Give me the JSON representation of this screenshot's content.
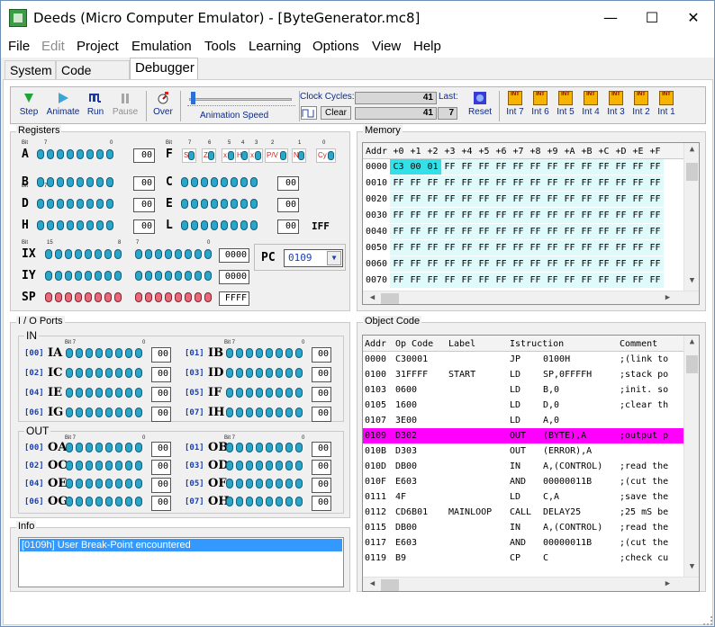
{
  "window": {
    "title": "Deeds (Micro Computer Emulator) - [ByteGenerator.mc8]",
    "min": "—",
    "max": "☐",
    "close": "✕"
  },
  "menu": [
    "File",
    "Edit",
    "Project",
    "Emulation",
    "Tools",
    "Learning",
    "Options",
    "View",
    "Help"
  ],
  "tabs": [
    "System",
    "Code Editor",
    "Debugger"
  ],
  "toolbar": {
    "buttons": [
      "Step",
      "Animate",
      "Run",
      "Pause",
      "Over"
    ],
    "animate_speed": "Animation Speed",
    "clock_label": "Clock Cycles:",
    "last_label": "Last:",
    "clear": "Clear",
    "clock1": "41",
    "clock2": "41",
    "last": "7",
    "reset": "Reset",
    "ints": [
      "Int 7",
      "Int 6",
      "Int 5",
      "Int 4",
      "Int 3",
      "Int 2",
      "Int 1"
    ]
  },
  "registers": {
    "title": "Registers",
    "bit_label": "Bit",
    "b7": "7",
    "b0": "0",
    "b15": "15",
    "b8": "8",
    "A": {
      "name": "A",
      "val": "00"
    },
    "B": {
      "name": "B",
      "val": "00"
    },
    "D": {
      "name": "D",
      "val": "00"
    },
    "H": {
      "name": "H",
      "val": "00"
    },
    "C": {
      "name": "C",
      "val": "00"
    },
    "E": {
      "name": "E",
      "val": "00"
    },
    "L": {
      "name": "L",
      "val": "00"
    },
    "F": {
      "name": "F",
      "flags": [
        "S",
        "Z",
        "x",
        "H",
        "x",
        "P/V",
        "N",
        "Cy"
      ],
      "bits": [
        "7",
        "6",
        "5",
        "4",
        "3",
        "2",
        "1",
        "0"
      ]
    },
    "IFF": "IFF",
    "IX": {
      "name": "IX",
      "val": "0000"
    },
    "IY": {
      "name": "IY",
      "val": "0000"
    },
    "SP": {
      "name": "SP",
      "val": "FFFF"
    },
    "PC": {
      "name": "PC",
      "val": "0109"
    }
  },
  "memory": {
    "title": "Memory",
    "header": [
      "Addr",
      "+0",
      "+1",
      "+2",
      "+3",
      "+4",
      "+5",
      "+6",
      "+7",
      "+8",
      "+9",
      "+A",
      "+B",
      "+C",
      "+D",
      "+E",
      "+F"
    ],
    "rows": [
      [
        "0000",
        "C3",
        "00",
        "01",
        "FF",
        "FF",
        "FF",
        "FF",
        "FF",
        "FF",
        "FF",
        "FF",
        "FF",
        "FF",
        "FF",
        "FF",
        "FF"
      ],
      [
        "0010",
        "FF",
        "FF",
        "FF",
        "FF",
        "FF",
        "FF",
        "FF",
        "FF",
        "FF",
        "FF",
        "FF",
        "FF",
        "FF",
        "FF",
        "FF",
        "FF"
      ],
      [
        "0020",
        "FF",
        "FF",
        "FF",
        "FF",
        "FF",
        "FF",
        "FF",
        "FF",
        "FF",
        "FF",
        "FF",
        "FF",
        "FF",
        "FF",
        "FF",
        "FF"
      ],
      [
        "0030",
        "FF",
        "FF",
        "FF",
        "FF",
        "FF",
        "FF",
        "FF",
        "FF",
        "FF",
        "FF",
        "FF",
        "FF",
        "FF",
        "FF",
        "FF",
        "FF"
      ],
      [
        "0040",
        "FF",
        "FF",
        "FF",
        "FF",
        "FF",
        "FF",
        "FF",
        "FF",
        "FF",
        "FF",
        "FF",
        "FF",
        "FF",
        "FF",
        "FF",
        "FF"
      ],
      [
        "0050",
        "FF",
        "FF",
        "FF",
        "FF",
        "FF",
        "FF",
        "FF",
        "FF",
        "FF",
        "FF",
        "FF",
        "FF",
        "FF",
        "FF",
        "FF",
        "FF"
      ],
      [
        "0060",
        "FF",
        "FF",
        "FF",
        "FF",
        "FF",
        "FF",
        "FF",
        "FF",
        "FF",
        "FF",
        "FF",
        "FF",
        "FF",
        "FF",
        "FF",
        "FF"
      ],
      [
        "0070",
        "FF",
        "FF",
        "FF",
        "FF",
        "FF",
        "FF",
        "FF",
        "FF",
        "FF",
        "FF",
        "FF",
        "FF",
        "FF",
        "FF",
        "FF",
        "FF"
      ]
    ],
    "highlight_color": "#5ef0f0"
  },
  "io": {
    "title": "I / O Ports",
    "in_label": "IN",
    "out_label": "OUT",
    "bit7": "Bit 7",
    "bit0": "0",
    "in": [
      {
        "id": "[00]",
        "name": "IA",
        "val": "00"
      },
      {
        "id": "[01]",
        "name": "IB",
        "val": "00"
      },
      {
        "id": "[02]",
        "name": "IC",
        "val": "00"
      },
      {
        "id": "[03]",
        "name": "ID",
        "val": "00"
      },
      {
        "id": "[04]",
        "name": "IE",
        "val": "00"
      },
      {
        "id": "[05]",
        "name": "IF",
        "val": "00"
      },
      {
        "id": "[06]",
        "name": "IG",
        "val": "00"
      },
      {
        "id": "[07]",
        "name": "IH",
        "val": "00"
      }
    ],
    "out": [
      {
        "id": "[00]",
        "name": "OA",
        "val": "00"
      },
      {
        "id": "[01]",
        "name": "OB",
        "val": "00"
      },
      {
        "id": "[02]",
        "name": "OC",
        "val": "00"
      },
      {
        "id": "[03]",
        "name": "OD",
        "val": "00"
      },
      {
        "id": "[04]",
        "name": "OE",
        "val": "00"
      },
      {
        "id": "[05]",
        "name": "OF",
        "val": "00"
      },
      {
        "id": "[06]",
        "name": "OG",
        "val": "00"
      },
      {
        "id": "[07]",
        "name": "OH",
        "val": "00"
      }
    ]
  },
  "info": {
    "title": "Info",
    "message": "[0109h] User Break-Point encountered"
  },
  "objcode": {
    "title": "Object Code",
    "header": [
      "Addr",
      "Op Code",
      "Label",
      "Istruction",
      "",
      "Comment"
    ],
    "rows": [
      [
        "0000",
        "C30001",
        "",
        "JP",
        "0100H",
        ";(link to"
      ],
      [
        "0100",
        "31FFFF",
        "START",
        "LD",
        "SP,0FFFFH",
        ";stack po"
      ],
      [
        "0103",
        "0600",
        "",
        "LD",
        "B,0",
        ";init. so"
      ],
      [
        "0105",
        "1600",
        "",
        "LD",
        "D,0",
        ";clear th"
      ],
      [
        "0107",
        "3E00",
        "",
        "LD",
        "A,0",
        ""
      ],
      [
        "0109",
        "D302",
        "",
        "OUT",
        "(BYTE),A",
        ";output p"
      ],
      [
        "010B",
        "D303",
        "",
        "OUT",
        "(ERROR),A",
        ""
      ],
      [
        "010D",
        "DB00",
        "",
        "IN",
        "A,(CONTROL)",
        ";read the"
      ],
      [
        "010F",
        "E603",
        "",
        "AND",
        "00000011B",
        ";(cut the"
      ],
      [
        "0111",
        "4F",
        "",
        "LD",
        "C,A",
        ";save the"
      ],
      [
        "0112",
        "CD6B01",
        "MAINLOOP",
        "CALL",
        "DELAY25",
        ";25 mS be"
      ],
      [
        "0115",
        "DB00",
        "",
        "IN",
        "A,(CONTROL)",
        ";read the"
      ],
      [
        "0117",
        "E603",
        "",
        "AND",
        "00000011B",
        ";(cut the"
      ],
      [
        "0119",
        "B9",
        "",
        "CP",
        "C",
        ";check cu"
      ]
    ],
    "highlight_row": 5,
    "highlight_color": "#ff00ff"
  }
}
